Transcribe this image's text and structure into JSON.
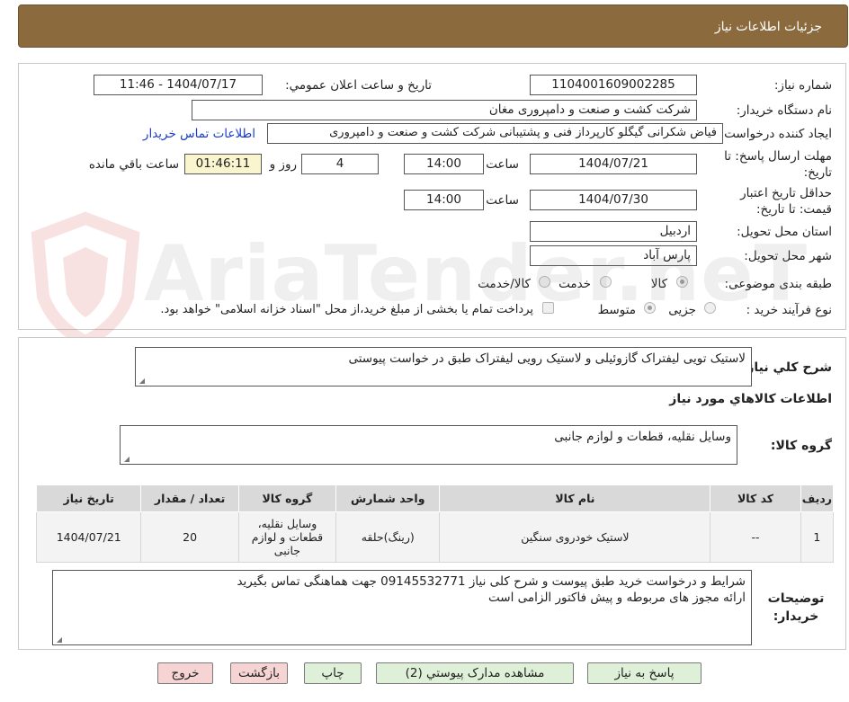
{
  "header": {
    "title": "جزئیات اطلاعات نیاز"
  },
  "form": {
    "need_number_label": "شماره نیاز:",
    "need_number": "1104001609002285",
    "announce_label": "تاریخ و ساعت اعلان عمومي:",
    "announce_value": "1404/07/17 - 11:46",
    "buyer_org_label": "نام دستگاه خريدار:",
    "buyer_org": "شرکت کشت و صنعت و دامپروری مغان",
    "creator_label": "ایجاد کننده درخواست:",
    "creator": "فیاض شکرانی گیگلو کارپرداز فنی و پشتیبانی شرکت کشت و صنعت و دامپروری",
    "contact_link": "اطلاعات تماس خریدار",
    "deadline_label": "مهلت ارسال پاسخ: تا تاریخ:",
    "deadline_date": "1404/07/21",
    "time_label": "ساعت",
    "deadline_time": "14:00",
    "days_value": "4",
    "days_label": "روز و",
    "remaining_time": "01:46:11",
    "remaining_label": "ساعت باقي مانده",
    "validity_label": "حداقل تاريخ اعتبار قيمت: تا تاريخ:",
    "validity_date": "1404/07/30",
    "validity_time": "14:00",
    "province_label": "استان محل تحويل:",
    "province": "اردبیل",
    "city_label": "شهر محل تحويل:",
    "city": "پارس آباد",
    "category_label": "طبقه بندی موضوعی:",
    "category_options": [
      "کالا",
      "خدمت",
      "کالا/خدمت"
    ],
    "process_label": "نوع فرآيند خريد :",
    "process_options": [
      "جزیی",
      "متوسط"
    ],
    "treasury_note": "پرداخت تمام يا بخشی از مبلغ خريد،از محل \"اسناد خزانه اسلامی\" خواهد بود."
  },
  "summary": {
    "label": "شرح کلي نياز:",
    "text": "لاستیک تویی لیفتراک گازوئیلی و لاستیک رویی لیفتراک طبق در خواست پیوستی",
    "goods_info_title": "اطلاعات کالاهاي مورد نياز",
    "group_label": "گروه کالا:",
    "group_text": "وسایل نقلیه، قطعات و لوازم جانبی"
  },
  "table": {
    "headers": [
      "رديف",
      "کد کالا",
      "نام کالا",
      "واحد شمارش",
      "گروه کالا",
      "تعداد / مقدار",
      "تاريخ نياز"
    ],
    "rows": [
      [
        "1",
        "--",
        "لاستیک خودروی سنگین",
        "(رينگ)حلقه",
        "وسایل نقلیه، قطعات و لوازم جانبی",
        "20",
        "1404/07/21"
      ]
    ]
  },
  "notes": {
    "label": "توضيحات خريدار:",
    "line1": "شرایط و درخواست خرید طبق پیوست و شرح کلی نیاز 09145532771 جهت هماهنگی تماس بگیرید",
    "line2": "ارائه مجوز های مربوطه و پیش فاکتور الزامی است"
  },
  "buttons": {
    "reply": "پاسخ به نياز",
    "attachments": "مشاهده مدارک پيوستي (2)",
    "print": "چاپ",
    "back": "بازگشت",
    "exit": "خروج"
  },
  "watermark": {
    "text": "AriaTender.neT"
  },
  "colors": {
    "header_bg": "#8b6a3e",
    "link": "#1a3ccc",
    "remaining_bg": "#fbf5cf",
    "green_btn": "#dff0d8",
    "pink_btn": "#f7d4d4"
  }
}
